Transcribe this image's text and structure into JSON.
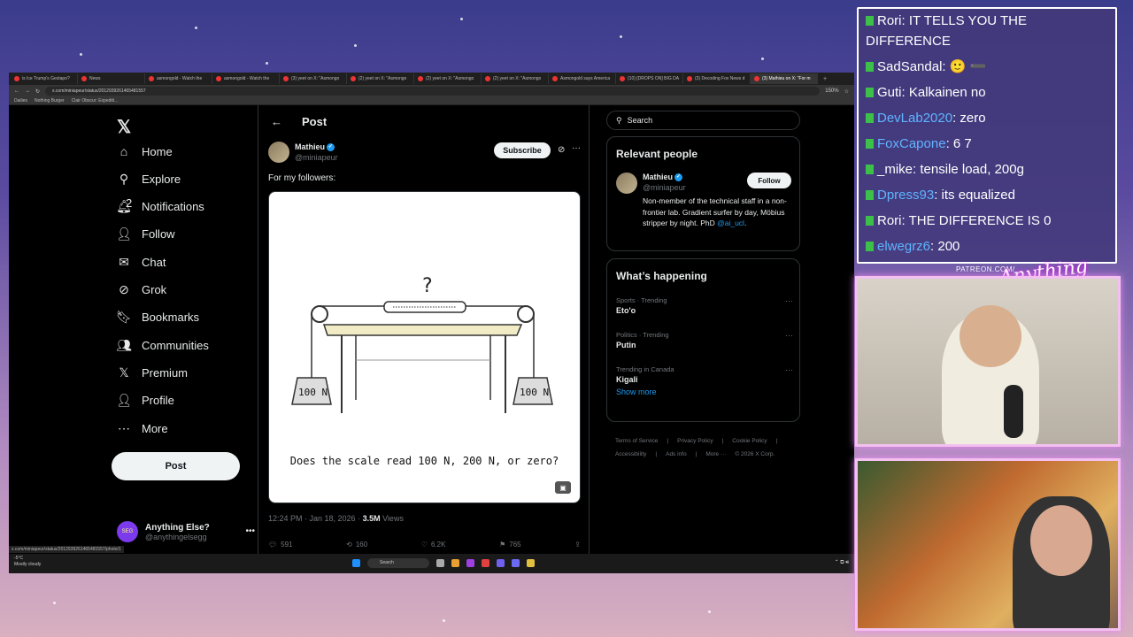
{
  "browser": {
    "tabs": [
      "is Ice Trump's Gestapo?",
      "News",
      "asmongold - Watch the",
      "asmongold - Watch the",
      "(3) yeet on X: \"Asmongo",
      "(2) yeet on X: \"Asmongo",
      "(2) yeet on X: \"Asmongo",
      "(2) yeet on X: \"Asmongo",
      "Asmongold says America",
      "(10) [DROPS ON] BIG DA",
      "(3) Decoding Fox News d",
      "(3) Mathieu on X: \"For m"
    ],
    "active_tab_index": 11,
    "url": "x.com/miniapeur/status/2012939261465481557",
    "zoom": "150%",
    "bookmarks": [
      "Dailies",
      "Nothing Burger",
      "Clair Obscur: Expediti..."
    ],
    "status_url": "x.com/miniapeur/status/2012939261465481557/photo/1",
    "weather": {
      "temp": "-5°C",
      "desc": "Mostly cloudy"
    },
    "taskbar_search": "Search"
  },
  "nav": {
    "items": [
      {
        "label": "Home",
        "icon": "home-icon",
        "glyph": "⌂"
      },
      {
        "label": "Explore",
        "icon": "search-icon",
        "glyph": "⚲"
      },
      {
        "label": "Notifications",
        "icon": "bell-icon",
        "glyph": "🔔︎",
        "badge": "2"
      },
      {
        "label": "Follow",
        "icon": "follow-icon",
        "glyph": "👤︎"
      },
      {
        "label": "Chat",
        "icon": "chat-icon",
        "glyph": "✉"
      },
      {
        "label": "Grok",
        "icon": "grok-icon",
        "glyph": "⊘"
      },
      {
        "label": "Bookmarks",
        "icon": "bookmark-icon",
        "glyph": "🔖︎"
      },
      {
        "label": "Communities",
        "icon": "communities-icon",
        "glyph": "👥︎"
      },
      {
        "label": "Premium",
        "icon": "x-icon",
        "glyph": "𝕏"
      },
      {
        "label": "Profile",
        "icon": "profile-icon",
        "glyph": "👤︎"
      },
      {
        "label": "More",
        "icon": "more-circle-icon",
        "glyph": "⋯"
      }
    ],
    "post_button": "Post",
    "account": {
      "name": "Anything Else?",
      "handle": "@anythingelsegg",
      "avatar_text": "SEG"
    }
  },
  "post": {
    "header_title": "Post",
    "author_name": "Mathieu",
    "author_handle": "@miniapeur",
    "subscribe_label": "Subscribe",
    "text": "For my followers:",
    "image_question": "Does the scale read 100 N, 200 N, or zero?",
    "weight_label_left": "100 N",
    "weight_label_right": "100 N",
    "question_mark": "?",
    "time": "12:24 PM · Jan 18, 2026 · ",
    "views_count": "3.5M",
    "views_label": " Views",
    "replies": "591",
    "reposts": "160",
    "likes": "6.2K",
    "bookmarks": "765"
  },
  "sidebar": {
    "search_placeholder": "Search",
    "relevant_title": "Relevant people",
    "person": {
      "name": "Mathieu",
      "handle": "@miniapeur",
      "follow_label": "Follow",
      "bio": "Non-member of the technical staff in a non-frontier lab. Gradient surfer by day, Möbius stripper by night. PhD ",
      "bio_link": "@ai_ucl",
      "bio_end": "."
    },
    "happening_title": "What’s happening",
    "trends": [
      {
        "category": "Sports · Trending",
        "name": "Eto'o"
      },
      {
        "category": "Politics · Trending",
        "name": "Putin"
      },
      {
        "category": "Trending in Canada",
        "name": "Kigali"
      }
    ],
    "show_more": "Show more",
    "footer": [
      "Terms of Service",
      "|",
      "Privacy Policy",
      "|",
      "Cookie Policy",
      "|",
      "Accessibility",
      "|",
      "Ads info",
      "|",
      "More ···",
      "© 2026 X Corp."
    ]
  },
  "chat": {
    "messages": [
      {
        "user": "Rori",
        "text": ": IT TELLS YOU THE DIFFERENCE",
        "color": "#ffffff",
        "badge": ""
      },
      {
        "user": "SadSandal",
        "text": ": 🙂 ➖",
        "color": "#ffffff",
        "badge": "#3cc04a"
      },
      {
        "user": "Guti",
        "text": ": Kalkainen no",
        "color": "#ffffff",
        "badge": "#3cc04a"
      },
      {
        "user": "DevLab2020",
        "text": ": zero",
        "color": "#5fb4ff",
        "badge": "#3cc04a"
      },
      {
        "user": "FoxCapone",
        "text": ": 6 7",
        "color": "#5fb4ff",
        "badge": "#3cc04a"
      },
      {
        "user": "_mike",
        "text": ": tensile load, 200g",
        "color": "#ffffff",
        "badge": "#3cc04a"
      },
      {
        "user": "Dpress93",
        "text": ": its equalized",
        "color": "#5fb4ff",
        "badge": "#3cc04a"
      },
      {
        "user": "Rori",
        "text": ": THE DIFFERENCE IS 0",
        "color": "#ffffff",
        "badge": "#3cc04a"
      },
      {
        "user": "elwegrz6",
        "text": ": 200",
        "color": "#5fb4ff",
        "badge": "#3cc04a"
      }
    ]
  },
  "stream": {
    "patreon_label": "PATREON.COM/",
    "brand": "Anything Else?"
  }
}
